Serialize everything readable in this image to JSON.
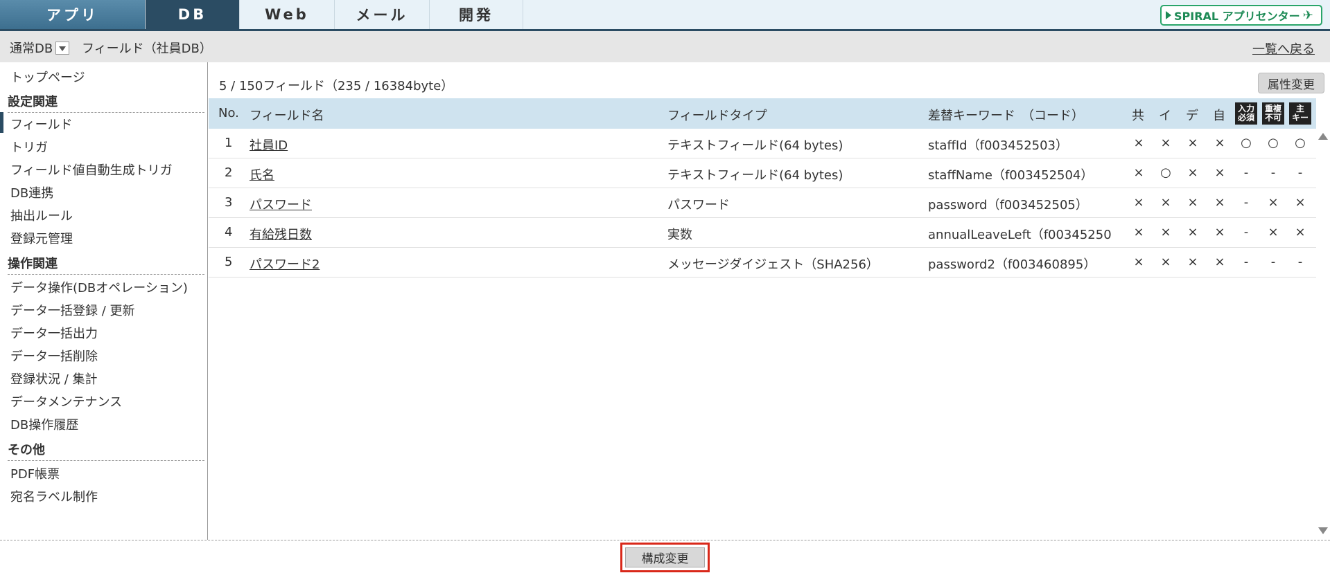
{
  "topnav": {
    "tabs": [
      {
        "label": "アプリ"
      },
      {
        "label": "DB"
      },
      {
        "label": "Web"
      },
      {
        "label": "メール"
      },
      {
        "label": "開発"
      }
    ],
    "active_tab": "DB",
    "spiral_button": "SPIRAL アプリセンター"
  },
  "subbar": {
    "db_type": "通常DB",
    "breadcrumb": "フィールド（社員DB）",
    "back_link": "一覧へ戻る"
  },
  "sidebar": {
    "top": "トップページ",
    "sections": [
      {
        "heading": "設定関連",
        "items": [
          "フィールド",
          "トリガ",
          "フィールド値自動生成トリガ",
          "DB連携",
          "抽出ルール",
          "登録元管理"
        ]
      },
      {
        "heading": "操作関連",
        "items": [
          "データ操作(DBオペレーション)",
          "データ一括登録 / 更新",
          "データ一括出力",
          "データ一括削除",
          "登録状況 / 集計",
          "データメンテナンス",
          "DB操作履歴"
        ]
      },
      {
        "heading": "その他",
        "items": [
          "PDF帳票",
          "宛名ラベル制作"
        ]
      }
    ],
    "active_item": "フィールド"
  },
  "main": {
    "count_text": "5 / 150フィールド（235 / 16384byte）",
    "attr_button": "属性変更",
    "columns": {
      "no": "No.",
      "name": "フィールド名",
      "type": "フィールドタイプ",
      "keyword": "差替キーワード　（コード）",
      "f1": "共",
      "f2": "イ",
      "f3": "デ",
      "f4": "自",
      "badge1_top": "入力",
      "badge1_bottom": "必須",
      "badge2_top": "重複",
      "badge2_bottom": "不可",
      "badge3_top": "主",
      "badge3_bottom": "キー"
    },
    "rows": [
      {
        "no": "1",
        "name": "社員ID",
        "type": "テキストフィールド(64 bytes)",
        "keyword": "staffId（f003452503）",
        "flags": [
          "×",
          "×",
          "×",
          "×",
          "○",
          "○",
          "○"
        ]
      },
      {
        "no": "2",
        "name": "氏名",
        "type": "テキストフィールド(64 bytes)",
        "keyword": "staffName（f003452504）",
        "flags": [
          "×",
          "○",
          "×",
          "×",
          "-",
          "-",
          "-"
        ]
      },
      {
        "no": "3",
        "name": "パスワード",
        "type": "パスワード",
        "keyword": "password（f003452505）",
        "flags": [
          "×",
          "×",
          "×",
          "×",
          "-",
          "×",
          "×"
        ]
      },
      {
        "no": "4",
        "name": "有給残日数",
        "type": "実数",
        "keyword": "annualLeaveLeft（f00345250",
        "flags": [
          "×",
          "×",
          "×",
          "×",
          "-",
          "×",
          "×"
        ]
      },
      {
        "no": "5",
        "name": "パスワード2",
        "type": "メッセージダイジェスト（SHA256）",
        "keyword": "password2（f003460895）",
        "flags": [
          "×",
          "×",
          "×",
          "×",
          "-",
          "-",
          "-"
        ]
      }
    ]
  },
  "footer": {
    "config_button": "構成変更"
  }
}
